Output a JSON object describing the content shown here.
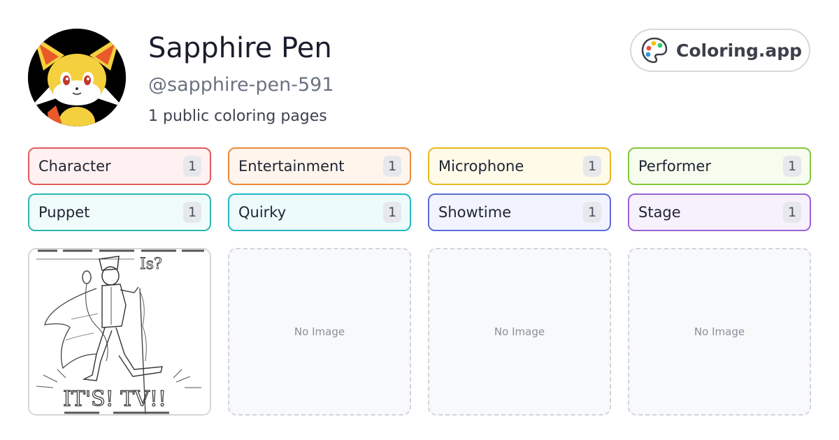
{
  "profile": {
    "name": "Sapphire Pen",
    "handle": "@sapphire-pen-591",
    "public_count": "1 public coloring pages",
    "avatar_icon": "fox-avatar"
  },
  "brand": {
    "label": "Coloring.app",
    "icon": "palette-icon"
  },
  "tags": [
    {
      "label": "Character",
      "count": "1",
      "border": "#e25b5b",
      "bg": "#fff1f1"
    },
    {
      "label": "Entertainment",
      "count": "1",
      "border": "#ea8a3a",
      "bg": "#fff5ec"
    },
    {
      "label": "Microphone",
      "count": "1",
      "border": "#e8b822",
      "bg": "#fffbe8"
    },
    {
      "label": "Performer",
      "count": "1",
      "border": "#86c63a",
      "bg": "#f6fdef"
    },
    {
      "label": "Puppet",
      "count": "1",
      "border": "#2bb7ae",
      "bg": "#effcfa"
    },
    {
      "label": "Quirky",
      "count": "1",
      "border": "#21b8c4",
      "bg": "#eefbfc"
    },
    {
      "label": "Showtime",
      "count": "1",
      "border": "#5f6bd8",
      "bg": "#f1f3fe"
    },
    {
      "label": "Stage",
      "count": "1",
      "border": "#9b63d8",
      "bg": "#f7f1fd"
    }
  ],
  "cards": [
    {
      "type": "image",
      "caption_top": "Is?",
      "caption_bottom": "IT'S! TV!!"
    },
    {
      "type": "empty",
      "placeholder": "No Image"
    },
    {
      "type": "empty",
      "placeholder": "No Image"
    },
    {
      "type": "empty",
      "placeholder": "No Image"
    }
  ]
}
